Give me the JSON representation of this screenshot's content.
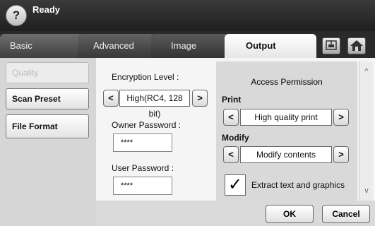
{
  "header": {
    "help_icon_label": "?",
    "status": "Ready"
  },
  "tabs": {
    "basic": "Basic",
    "advanced": "Advanced",
    "image": "Image",
    "output": "Output"
  },
  "sidebar": {
    "quality": "Quality",
    "scan_preset": "Scan Preset",
    "file_format": "File Format"
  },
  "encryption": {
    "label": "Encryption Level :",
    "value": "High(RC4, 128 bit)",
    "prev": "<",
    "next": ">"
  },
  "owner_password": {
    "label": "Owner Password :",
    "value": "****"
  },
  "user_password": {
    "label": "User Password :",
    "value": "****"
  },
  "access": {
    "title": "Access Permission",
    "print": {
      "label": "Print",
      "value": "High quality print",
      "prev": "<",
      "next": ">"
    },
    "modify": {
      "label": "Modify",
      "value": "Modify contents",
      "prev": "<",
      "next": ">"
    },
    "extract": {
      "label": "Extract text and graphics",
      "checked": true,
      "check_glyph": "✓"
    }
  },
  "scroll": {
    "up": "^",
    "down": "v"
  },
  "footer": {
    "ok": "OK",
    "cancel": "Cancel"
  }
}
